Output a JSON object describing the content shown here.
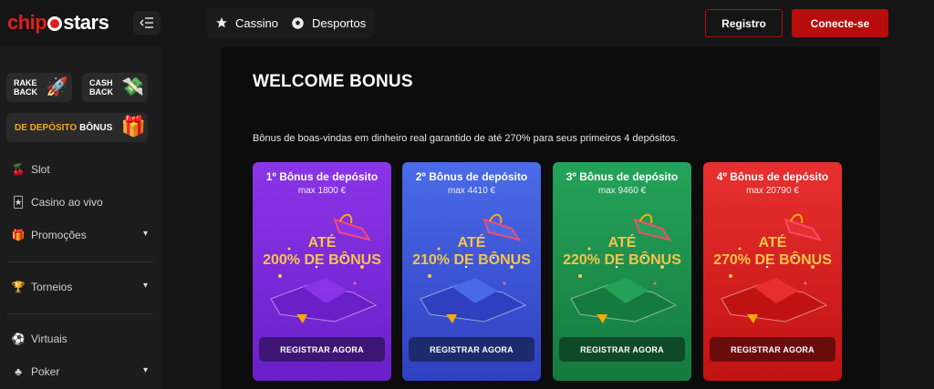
{
  "header": {
    "logo_part1": "chip",
    "logo_part2": "stars",
    "nav": [
      {
        "label": "Cassino",
        "icon": "star-icon"
      },
      {
        "label": "Desportos",
        "icon": "soccer-ball-icon"
      }
    ],
    "registro_label": "Registro",
    "conecte_label": "Conecte-se"
  },
  "sidebar": {
    "rakeback": {
      "line1": "RAKE",
      "line2": "BACK",
      "icon": "rocket-icon"
    },
    "cashback": {
      "line1": "CASH",
      "line2": "BACK",
      "icon": "money-icon"
    },
    "deposito": {
      "part1": "DE DEPÓSITO",
      "part2": "BÔNUS",
      "icon": "gift-icon"
    },
    "items": [
      {
        "label": "Slot",
        "icon": "cherry-icon"
      },
      {
        "label": "Casino ao vivo",
        "icon": "cards-icon"
      },
      {
        "label": "Promoções",
        "icon": "gift-icon"
      },
      {
        "label": "Torneios",
        "icon": "trophy-icon"
      },
      {
        "label": "Virtuais",
        "icon": "ball-icon"
      },
      {
        "label": "Poker",
        "icon": "club-icon"
      }
    ]
  },
  "main": {
    "title": "WELCOME BONUS",
    "description": "Bônus de boas-vindas em dinheiro real garantido de até 270% para seus primeiros 4 depósitos.",
    "cards": [
      {
        "heading": "1º Bônus de depósito",
        "max": "max 1800 €",
        "ate": "ATÉ",
        "percent": "200% DE BÔNUS",
        "button": "REGISTRAR AGORA",
        "color_top": "#8a35e8",
        "color_bottom": "#6a1fc8",
        "button_color": "#3d1574"
      },
      {
        "heading": "2º Bônus de depósito",
        "max": "max 4410 €",
        "ate": "ATÉ",
        "percent": "210% DE BÔNUS",
        "button": "REGISTRAR AGORA",
        "color_top": "#4a6be8",
        "color_bottom": "#2f3fc0",
        "button_color": "#1e2a6e"
      },
      {
        "heading": "3º Bônus de depósito",
        "max": "max 9460 €",
        "ate": "ATÉ",
        "percent": "220% DE BÔNUS",
        "button": "REGISTRAR AGORA",
        "color_top": "#25a35a",
        "color_bottom": "#157a3e",
        "button_color": "#0f4a28"
      },
      {
        "heading": "4º Bônus de depósito",
        "max": "max 20790 €",
        "ate": "ATÉ",
        "percent": "270% DE BÔNUS",
        "button": "REGISTRAR AGORA",
        "color_top": "#e8302f",
        "color_bottom": "#c11212",
        "button_color": "#6b0c0c"
      }
    ]
  },
  "colors": {
    "brand_red": "#e01e1e",
    "button_red": "#b80d0d",
    "bonus_gold": "#f7c548",
    "deposit_orange": "#f5a623"
  }
}
